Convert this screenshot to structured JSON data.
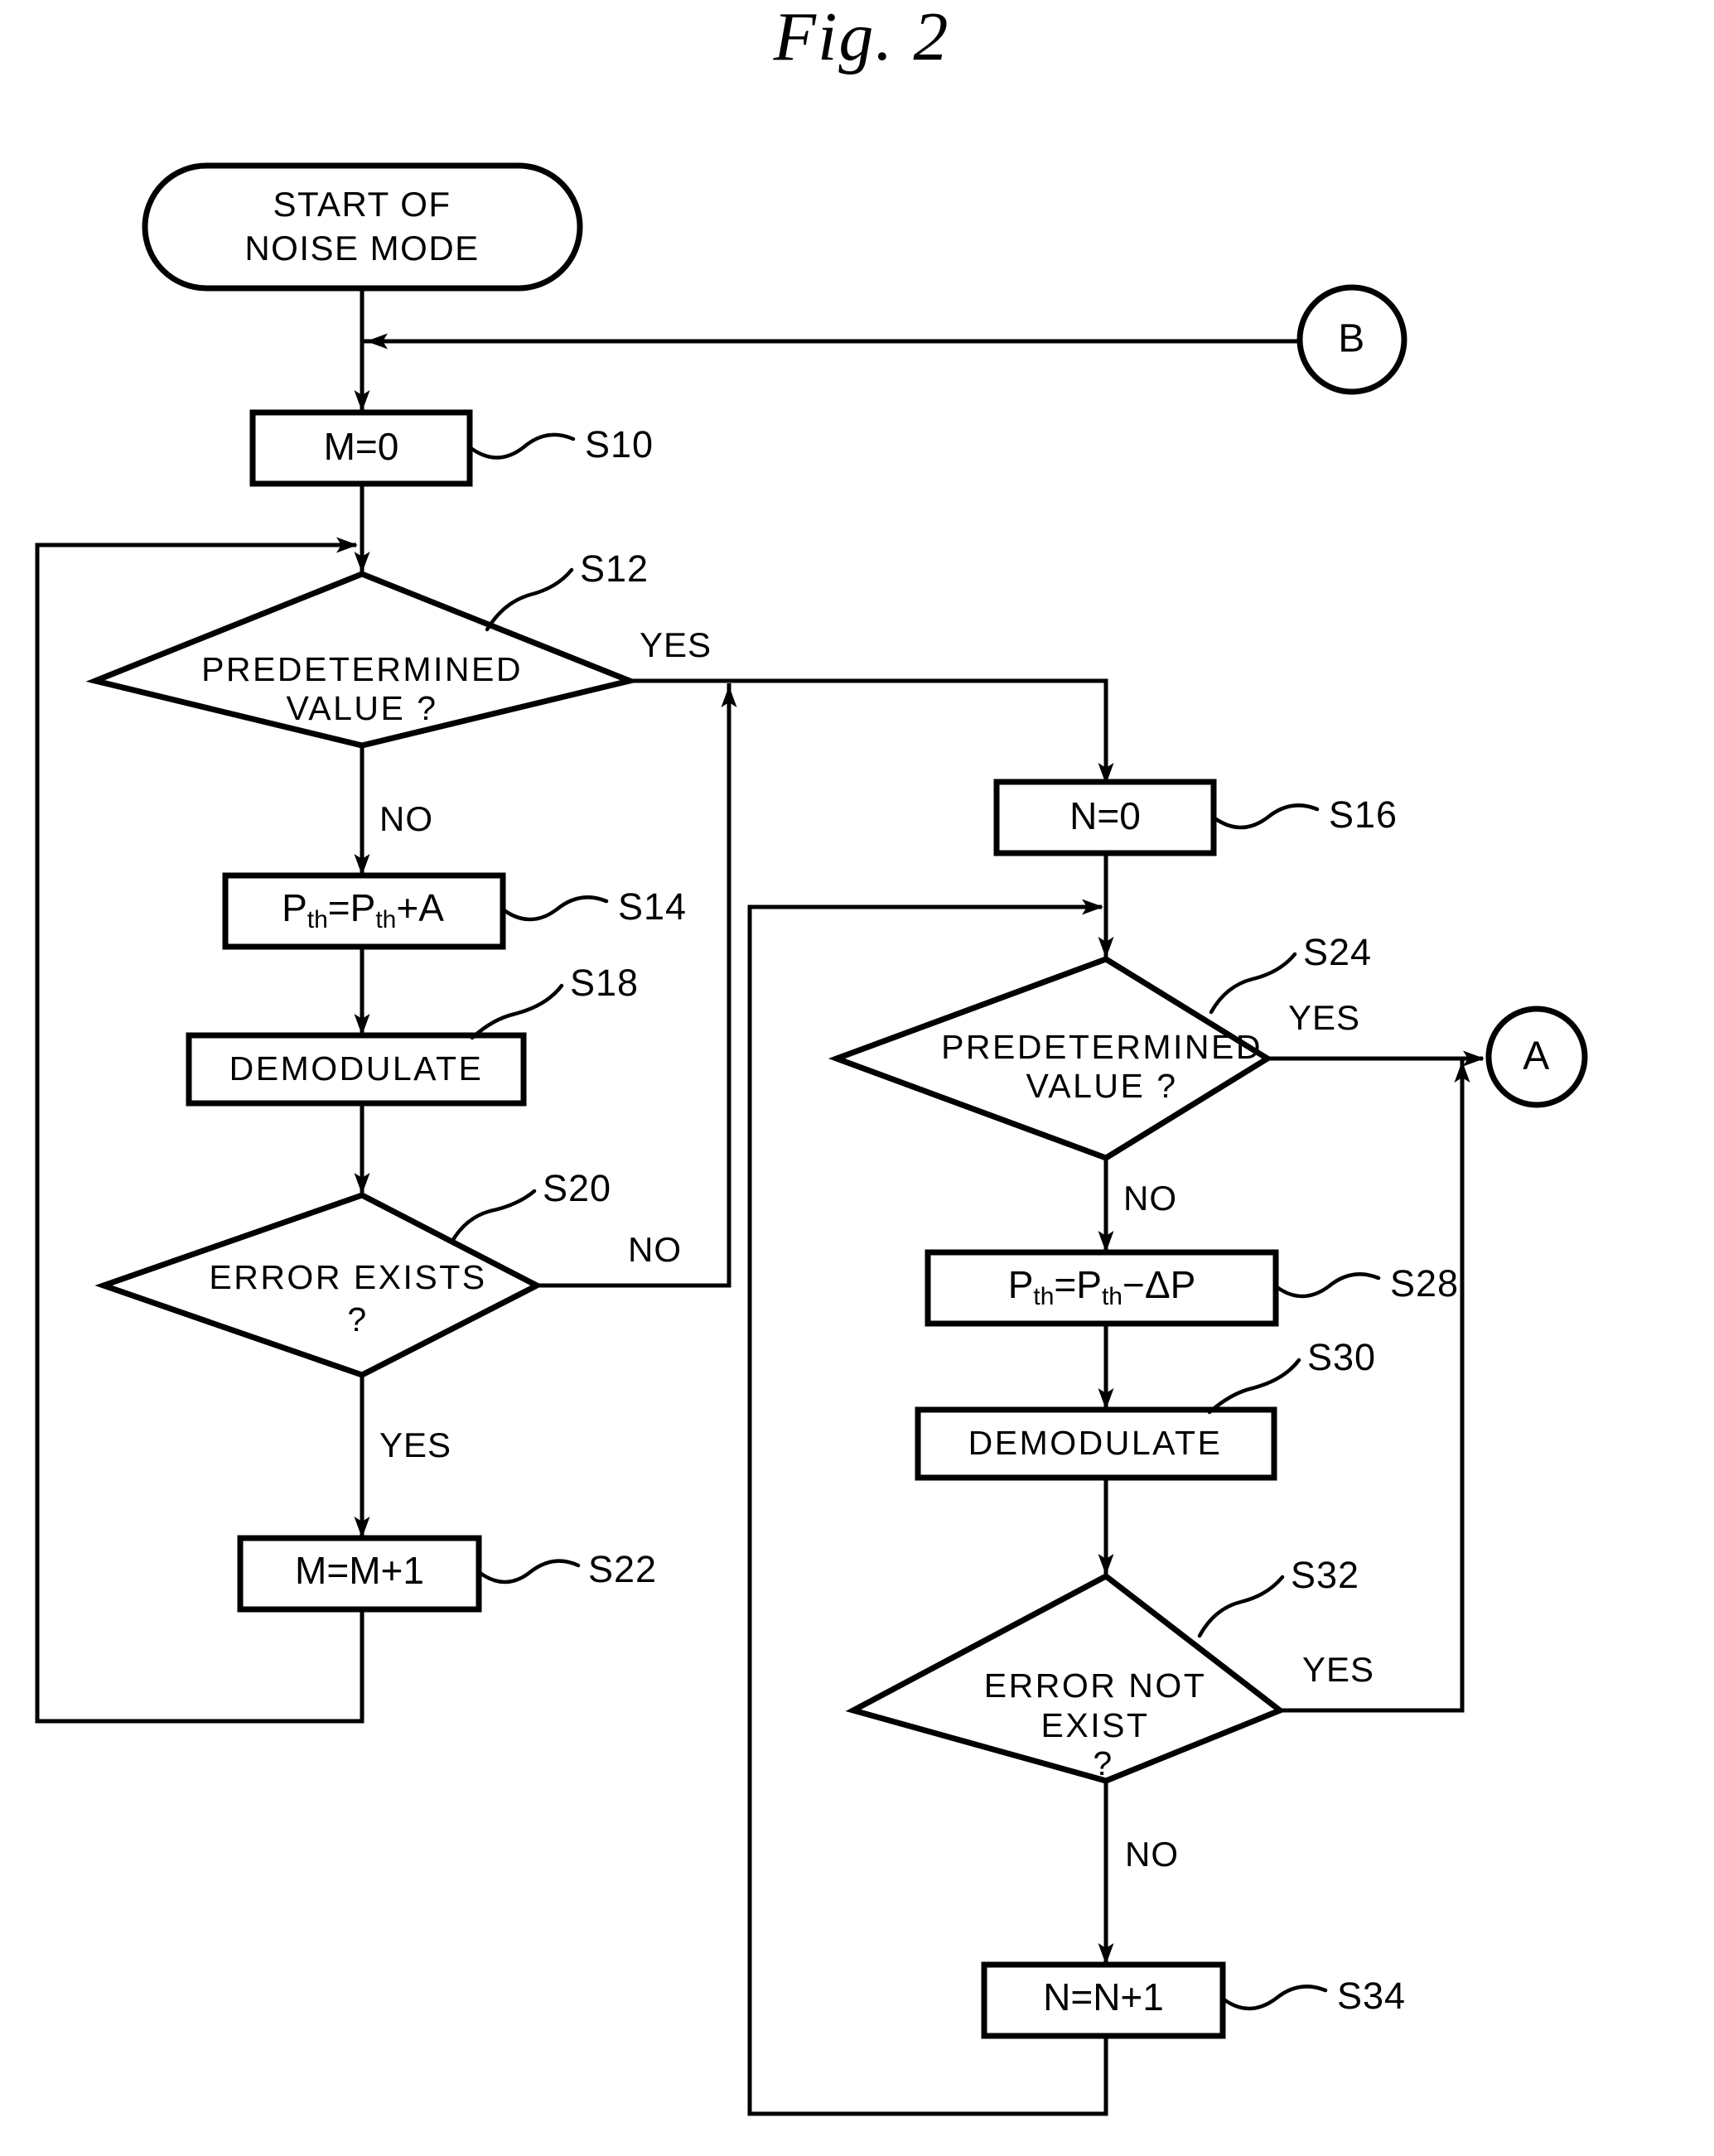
{
  "figure": {
    "title": "Fig. 2",
    "type": "flowchart"
  },
  "nodes": {
    "start": {
      "shape": "terminal",
      "line1": "START OF",
      "line2": "NOISE MODE"
    },
    "s10": {
      "shape": "process",
      "text": "M=0",
      "step": "S10"
    },
    "s12": {
      "shape": "decision",
      "line1": "PREDETERMINED",
      "line2": "VALUE ?",
      "step": "S12",
      "branch_yes": "YES",
      "branch_no": "NO"
    },
    "s14": {
      "shape": "process",
      "lhs_base": "P",
      "lhs_sub": "th",
      "eq": "=",
      "rhs_base": "P",
      "rhs_sub": "th",
      "op": "+",
      "operand": "A",
      "text": "Pth=Pth+A",
      "step": "S14"
    },
    "s18": {
      "shape": "process",
      "text": "DEMODULATE",
      "step": "S18"
    },
    "s20": {
      "shape": "decision",
      "line1": "ERROR EXISTS",
      "line2": "?",
      "step": "S20",
      "branch_no": "NO",
      "branch_yes": "YES"
    },
    "s22": {
      "shape": "process",
      "text": "M=M+1",
      "step": "S22"
    },
    "s16": {
      "shape": "process",
      "text": "N=0",
      "step": "S16"
    },
    "s24": {
      "shape": "decision",
      "line1": "PREDETERMINED",
      "line2": "VALUE ?",
      "step": "S24",
      "branch_yes": "YES",
      "branch_no": "NO"
    },
    "s28": {
      "shape": "process",
      "lhs_base": "P",
      "lhs_sub": "th",
      "eq": "=",
      "rhs_base": "P",
      "rhs_sub": "th",
      "op": "−",
      "operand": "ΔP",
      "text": "Pth=Pth−ΔP",
      "step": "S28"
    },
    "s30": {
      "shape": "process",
      "text": "DEMODULATE",
      "step": "S30"
    },
    "s32": {
      "shape": "decision",
      "line1": "ERROR NOT",
      "line2": "EXIST",
      "line3": "?",
      "step": "S32",
      "branch_yes": "YES",
      "branch_no": "NO"
    },
    "s34": {
      "shape": "process",
      "text": "N=N+1",
      "step": "S34"
    },
    "connector_a": {
      "shape": "connector",
      "label": "A"
    },
    "connector_b": {
      "shape": "connector",
      "label": "B"
    }
  },
  "colors": {
    "stroke": "#000000",
    "background": "#ffffff"
  }
}
